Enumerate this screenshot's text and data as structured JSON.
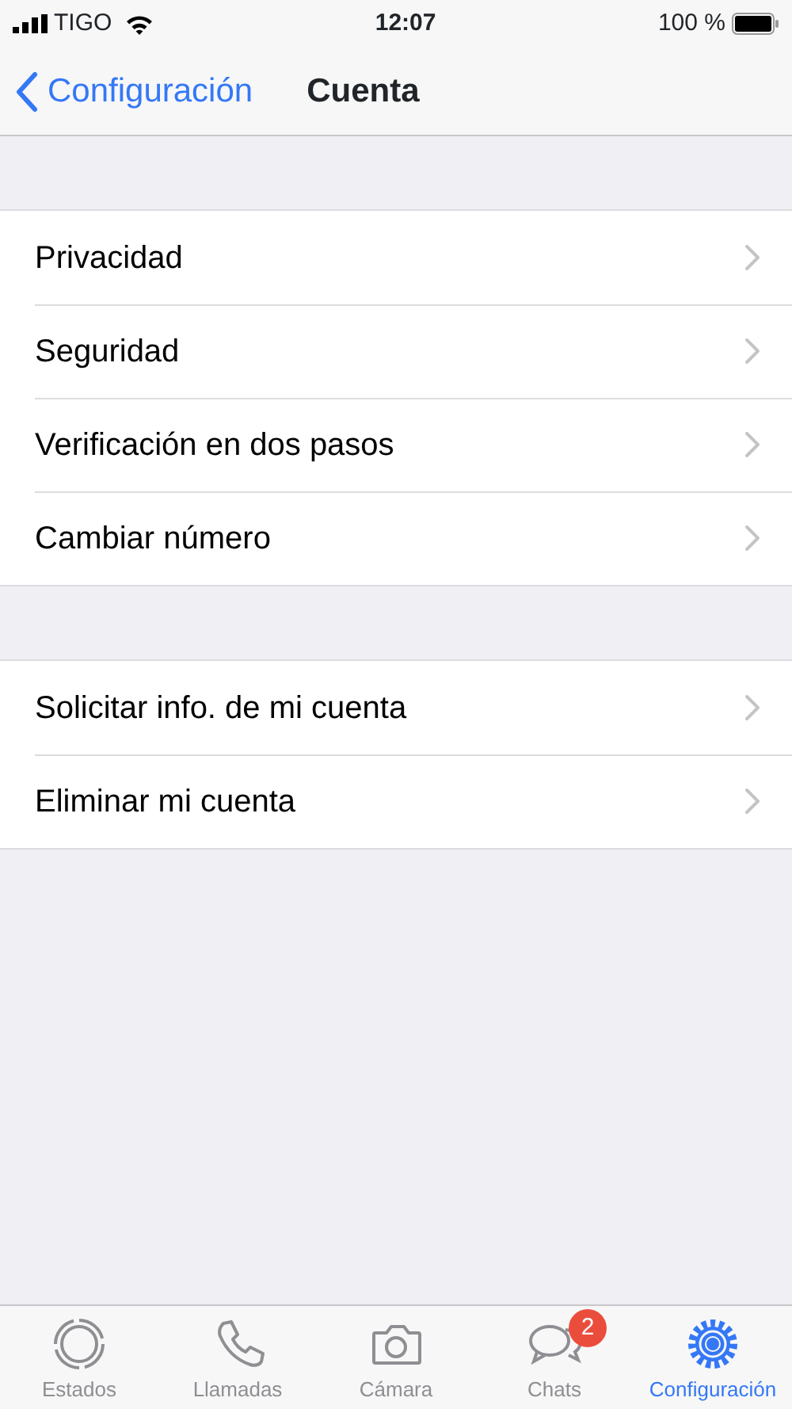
{
  "status_bar": {
    "carrier": "TIGO",
    "time": "12:07",
    "battery": "100 %"
  },
  "nav_bar": {
    "back": "Configuración",
    "title": "Cuenta"
  },
  "sections": [
    {
      "items": [
        {
          "label": "Privacidad"
        },
        {
          "label": "Seguridad"
        },
        {
          "label": "Verificación en dos pasos"
        },
        {
          "label": "Cambiar número"
        }
      ]
    },
    {
      "items": [
        {
          "label": "Solicitar info. de mi cuenta"
        },
        {
          "label": "Eliminar mi cuenta"
        }
      ]
    }
  ],
  "tab_bar": [
    {
      "label": "Estados",
      "selected": false
    },
    {
      "label": "Llamadas",
      "selected": false
    },
    {
      "label": "Cámara",
      "selected": false
    },
    {
      "label": "Chats",
      "selected": false,
      "badge": "2"
    },
    {
      "label": "Configuración",
      "selected": true
    }
  ]
}
